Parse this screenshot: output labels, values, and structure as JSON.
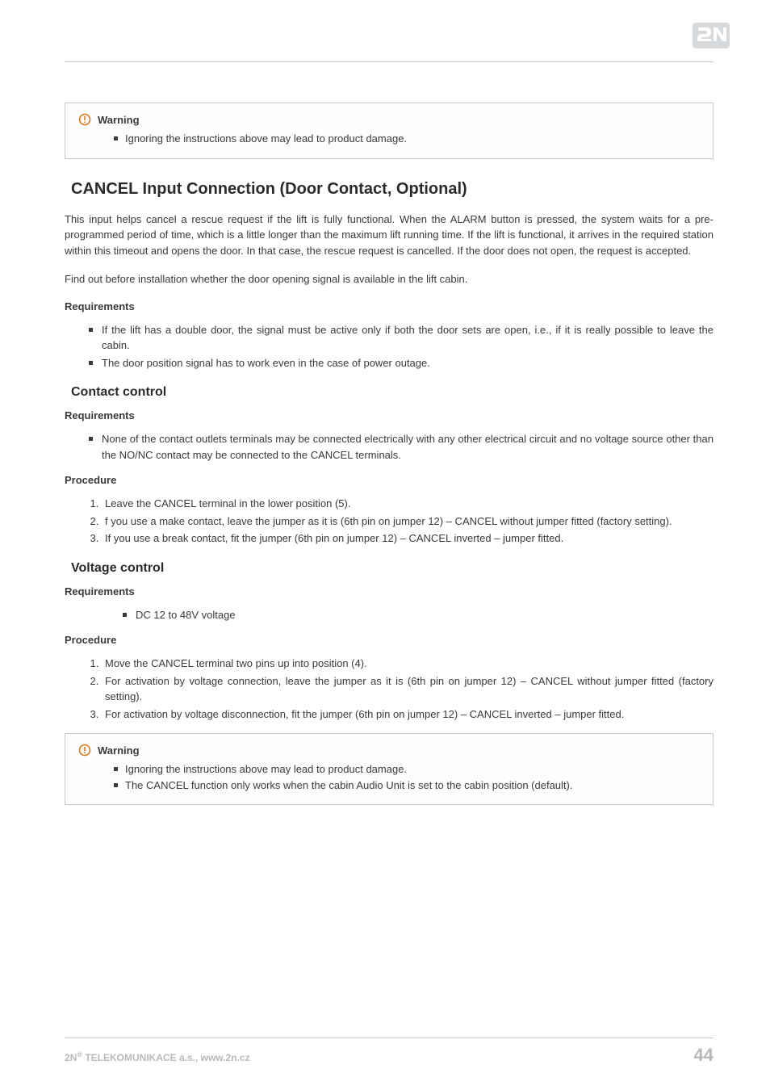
{
  "callout1": {
    "title": "Warning",
    "items": [
      "Ignoring the instructions above may lead to product damage."
    ]
  },
  "h2": "CANCEL Input Connection (Door Contact, Optional)",
  "para1": "This input helps cancel a rescue request if the lift is fully functional. When the ALARM button is pressed, the system waits for a pre-programmed period of time, which is a little longer than the maximum lift running time. If the lift is functional, it arrives in the required station within this timeout and opens the door. In that case, the rescue request is cancelled. If the door does not open, the request is accepted.",
  "para2": "Find out before installation whether the door opening signal is available in the lift cabin.",
  "req1_head": "Requirements",
  "req1_items": [
    "If the lift has a double door, the signal must be active only if both the door sets are open, i.e., if it is really possible to leave the cabin.",
    "The door position signal has to work even in the case of power outage."
  ],
  "h3a": "Contact control",
  "req2_head": "Requirements",
  "req2_items": [
    "None of the contact outlets terminals may be connected electrically with any other electrical circuit and no voltage source other than the NO/NC contact may be connected to the CANCEL terminals."
  ],
  "proc1_head": "Procedure",
  "proc1_items": [
    "Leave the CANCEL terminal in the lower position (5).",
    "f you use a make contact, leave the jumper as it is (6th pin on jumper 12) – CANCEL without jumper fitted (factory setting).",
    "If you use a break contact, fit the jumper (6th pin on jumper 12) – CANCEL inverted – jumper fitted."
  ],
  "h3b": "Voltage control",
  "req3_head": "Requirements",
  "req3_items": [
    "DC 12 to 48V voltage"
  ],
  "proc2_head": "Procedure",
  "proc2_items": [
    "Move the CANCEL terminal two pins up into position (4).",
    "For activation by voltage connection, leave the jumper as it is (6th pin on jumper 12) – CANCEL without jumper fitted (factory setting).",
    "For activation by voltage disconnection, fit the jumper (6th pin on jumper 12) – CANCEL inverted – jumper fitted."
  ],
  "callout2": {
    "title": "Warning",
    "items": [
      "Ignoring the instructions above may lead to product damage.",
      "The CANCEL function only works when the cabin Audio Unit is set to the cabin position (default)."
    ]
  },
  "footer": {
    "left_prefix": "2N",
    "left_reg": "®",
    "left_rest": " TELEKOMUNIKACE a.s., www.2n.cz",
    "page": "44"
  }
}
